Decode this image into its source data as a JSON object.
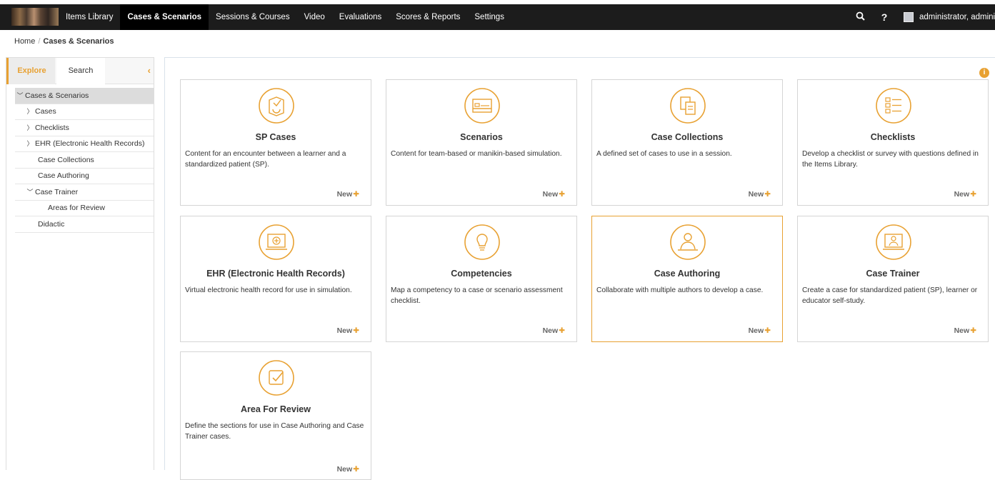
{
  "colors": {
    "accent": "#e8a132",
    "topbar": "#1c1c1c",
    "active_nav": "#000000"
  },
  "nav": {
    "items": [
      "Items Library",
      "Cases & Scenarios",
      "Sessions & Courses",
      "Video",
      "Evaluations",
      "Scores & Reports",
      "Settings"
    ],
    "active": "Cases & Scenarios",
    "icons": [
      "search-icon",
      "help-icon"
    ],
    "user": "administrator, administr"
  },
  "breadcrumb": {
    "home": "Home",
    "separator": "/",
    "current": "Cases & Scenarios"
  },
  "sidebar": {
    "tabs": [
      "Explore",
      "Search"
    ],
    "active_tab": "Explore",
    "tree": [
      {
        "label": "Cases & Scenarios",
        "level": 0,
        "chevron": "down",
        "selected": true
      },
      {
        "label": "Cases",
        "level": 1,
        "chevron": "right"
      },
      {
        "label": "Checklists",
        "level": 1,
        "chevron": "right"
      },
      {
        "label": "EHR (Electronic Health Records)",
        "level": 1,
        "chevron": "right"
      },
      {
        "label": "Case Collections",
        "level": 1,
        "chevron": "none"
      },
      {
        "label": "Case Authoring",
        "level": 1,
        "chevron": "none"
      },
      {
        "label": "Case Trainer",
        "level": 1,
        "chevron": "down"
      },
      {
        "label": "Areas for Review",
        "level": 2,
        "chevron": "none"
      },
      {
        "label": "Didactic",
        "level": 1,
        "chevron": "none"
      }
    ]
  },
  "cards": [
    {
      "title": "SP Cases",
      "icon": "sp-cases-icon",
      "desc": "Content for an encounter between a learner and a standardized patient (SP).",
      "new_label": "New"
    },
    {
      "title": "Scenarios",
      "icon": "scenarios-bed-icon",
      "desc": "Content for team-based or manikin-based simulation.",
      "new_label": "New"
    },
    {
      "title": "Case Collections",
      "icon": "case-collections-icon",
      "desc": "A defined set of cases to use in a session.",
      "new_label": "New"
    },
    {
      "title": "Checklists",
      "icon": "checklists-icon",
      "desc": "Develop a checklist or survey with questions defined in the Items Library.",
      "new_label": "New"
    },
    {
      "title": "EHR (Electronic Health Records)",
      "icon": "ehr-monitor-icon",
      "desc": "Virtual electronic health record for use in simulation.",
      "new_label": "New"
    },
    {
      "title": "Competencies",
      "icon": "competencies-bulb-icon",
      "desc": "Map a competency to a case or scenario assessment checklist.",
      "new_label": "New"
    },
    {
      "title": "Case Authoring",
      "icon": "case-authoring-icon",
      "desc": "Collaborate with multiple authors to develop a case.",
      "new_label": "New",
      "highlighted": true
    },
    {
      "title": "Case Trainer",
      "icon": "case-trainer-icon",
      "desc": "Create a case for standardized patient (SP), learner or educator self-study.",
      "new_label": "New"
    },
    {
      "title": "Area For Review",
      "icon": "area-for-review-icon",
      "desc": "Define the sections for use in Case Authoring and Case Trainer cases.",
      "new_label": "New"
    }
  ]
}
